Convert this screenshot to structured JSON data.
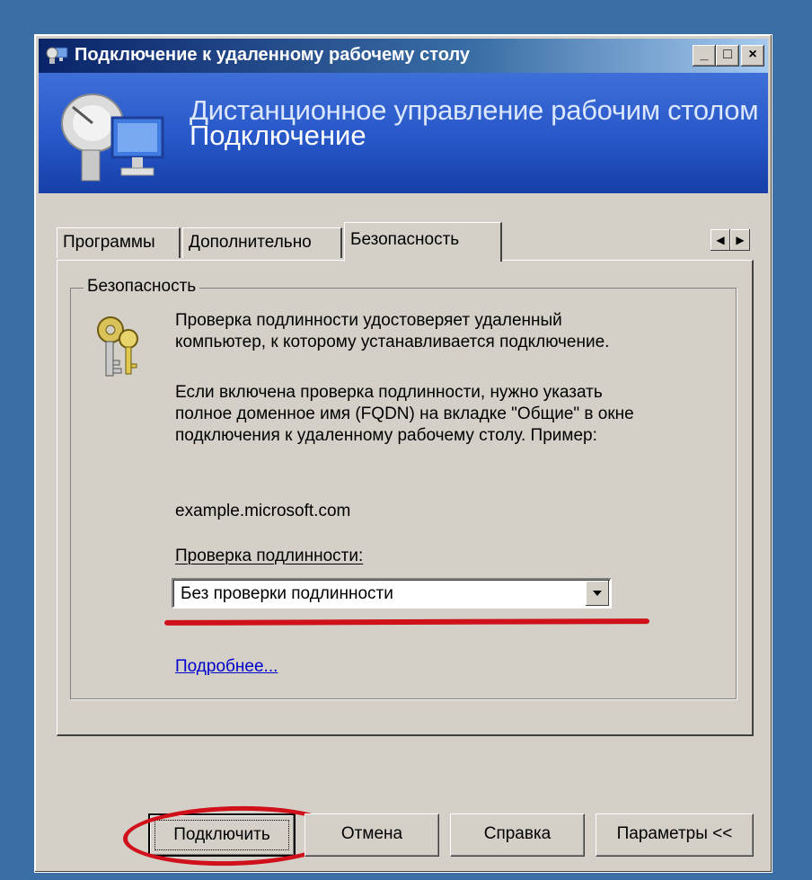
{
  "window": {
    "title": "Подключение к удаленному рабочему столу",
    "controls": {
      "minimize": "_",
      "maximize": "□",
      "close": "×"
    }
  },
  "banner": {
    "line1": "Дистанционное управление рабочим столом",
    "line2": "Подключение"
  },
  "tabs": [
    {
      "label": "Программы",
      "active": false
    },
    {
      "label": "Дополнительно",
      "active": false
    },
    {
      "label": "Безопасность",
      "active": true
    }
  ],
  "tab_scroll": {
    "left": "◀",
    "right": "▶"
  },
  "security": {
    "group_title": "Безопасность",
    "para1_line1": "Проверка подлинности удостоверяет удаленный",
    "para1_line2": "компьютер, к которому устанавливается подключение.",
    "para2_line1": "Если включена проверка подлинности, нужно указать",
    "para2_line2": "полное доменное имя (FQDN) на вкладке \"Общие\" в окне",
    "para2_line3": "подключения к удаленному рабочему столу. Пример:",
    "example": "example.microsoft.com",
    "auth_label": "Проверка подлинности:",
    "auth_value": "Без проверки подлинности",
    "more_link": "Подробнее..."
  },
  "buttons": {
    "connect": "Подключить",
    "cancel": "Отмена",
    "help": "Справка",
    "options": "Параметры <<"
  },
  "annotations_colors": {
    "highlight": "#d0101a"
  }
}
